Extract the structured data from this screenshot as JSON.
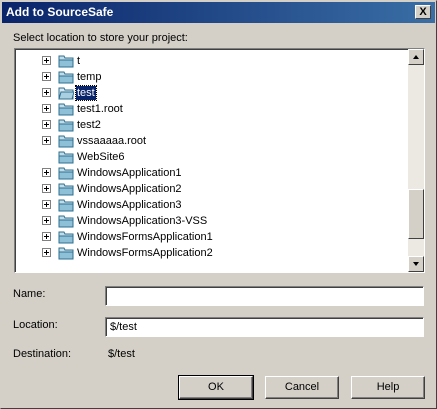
{
  "window": {
    "title": "Add to SourceSafe",
    "close_label": "X"
  },
  "prompt": "Select location to store your project:",
  "tree": {
    "items": [
      {
        "label": "t",
        "expandable": true,
        "selected": false
      },
      {
        "label": "temp",
        "expandable": true,
        "selected": false
      },
      {
        "label": "test",
        "expandable": true,
        "selected": true
      },
      {
        "label": "test1.root",
        "expandable": true,
        "selected": false
      },
      {
        "label": "test2",
        "expandable": true,
        "selected": false
      },
      {
        "label": "vssaaaaa.root",
        "expandable": true,
        "selected": false
      },
      {
        "label": "WebSite6",
        "expandable": false,
        "selected": false
      },
      {
        "label": "WindowsApplication1",
        "expandable": true,
        "selected": false
      },
      {
        "label": "WindowsApplication2",
        "expandable": true,
        "selected": false
      },
      {
        "label": "WindowsApplication3",
        "expandable": true,
        "selected": false
      },
      {
        "label": "WindowsApplication3-VSS",
        "expandable": true,
        "selected": false
      },
      {
        "label": "WindowsFormsApplication1",
        "expandable": true,
        "selected": false
      },
      {
        "label": "WindowsFormsApplication2",
        "expandable": true,
        "selected": false
      }
    ]
  },
  "form": {
    "name_label": "Name:",
    "name_value": "",
    "location_label": "Location:",
    "location_value": "$/test",
    "destination_label": "Destination:",
    "destination_value": "$/test"
  },
  "buttons": {
    "ok": "OK",
    "cancel": "Cancel",
    "help": "Help"
  },
  "colors": {
    "titlebar_start": "#0a246a",
    "titlebar_end": "#3a6ea5",
    "selection": "#0a246a",
    "dialog_bg": "#d4d0c8"
  }
}
